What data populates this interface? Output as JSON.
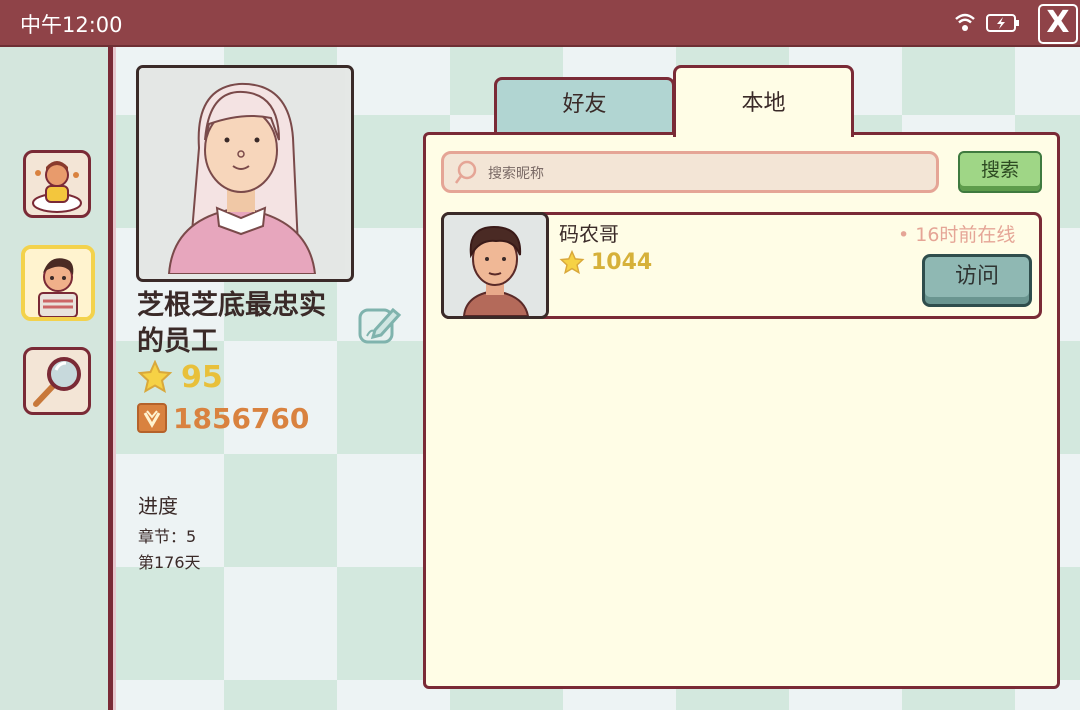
{
  "status_bar": {
    "time": "中午12:00",
    "close_label": "X"
  },
  "sidebar": {
    "items": [
      {
        "name": "social",
        "icon": "people-icon"
      },
      {
        "name": "profile",
        "icon": "avatar-icon",
        "active": true
      },
      {
        "name": "search",
        "icon": "magnifier-icon"
      }
    ]
  },
  "profile": {
    "name": "芝根芝底最忠实的员工",
    "stars": "95",
    "coins": "1856760",
    "progress_title": "进度",
    "chapter": "章节：5",
    "day": "第176天"
  },
  "tabs": {
    "friends": "好友",
    "local": "本地",
    "active": "local"
  },
  "search": {
    "placeholder": "搜索昵称",
    "value": "",
    "button": "搜索"
  },
  "friends": [
    {
      "name": "码农哥",
      "stars": "1044",
      "online": "• 16时前在线",
      "visit": "访问"
    }
  ],
  "colors": {
    "frame": "#7a2a36",
    "topbar": "#8f4348",
    "panel": "#fffde6",
    "star": "#e8c03a"
  }
}
